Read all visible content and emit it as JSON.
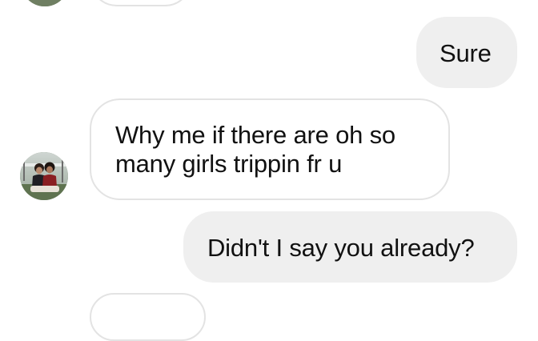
{
  "conversation": {
    "messages": [
      {
        "sender": "other",
        "text": ""
      },
      {
        "sender": "me",
        "text": "Sure"
      },
      {
        "sender": "other",
        "lines": [
          "Why me if there are oh so",
          "many girls trippin fr u"
        ]
      },
      {
        "sender": "me",
        "text": "Didn't I say you already?"
      },
      {
        "sender": "other",
        "text": ""
      }
    ]
  },
  "colors": {
    "incoming_bg": "#ffffff",
    "incoming_border": "#e3e3e3",
    "outgoing_bg": "#efefef",
    "text": "#111111"
  },
  "icons": {
    "avatar": "contact-avatar-photo"
  }
}
